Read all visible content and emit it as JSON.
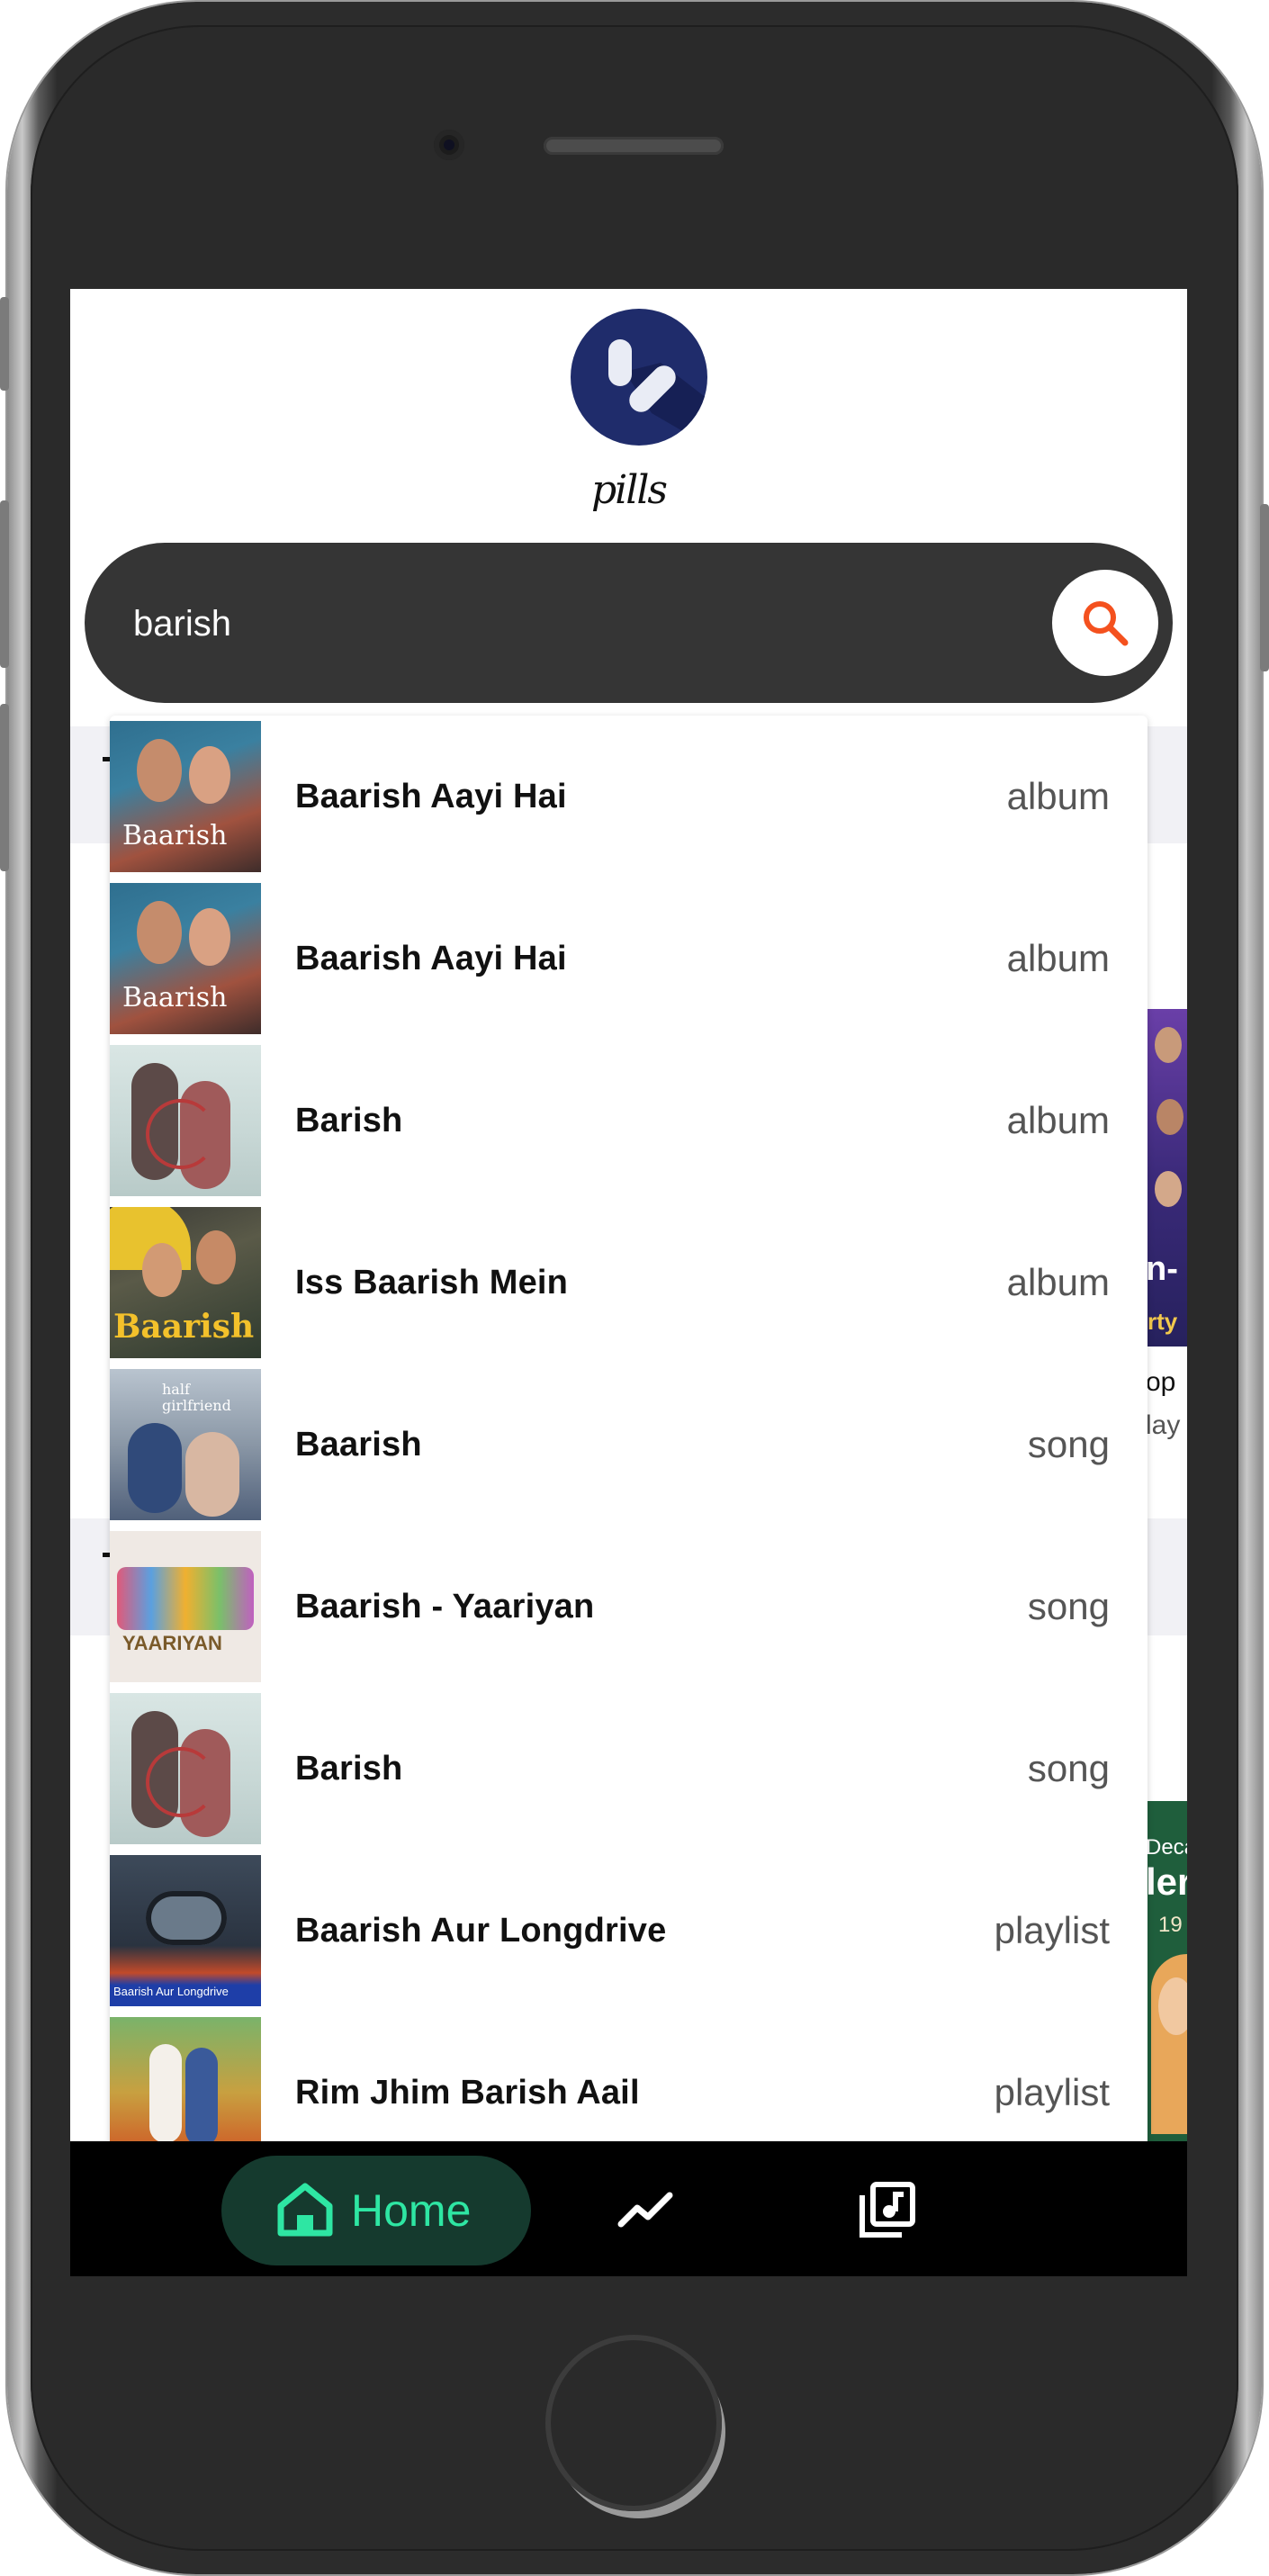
{
  "app": {
    "logo_text": "pills"
  },
  "search": {
    "value": "barish",
    "placeholder": ""
  },
  "results": [
    {
      "title": "Baarish Aayi Hai",
      "type": "album",
      "thumb": "baarish-aayi-hai-cover"
    },
    {
      "title": "Baarish Aayi Hai",
      "type": "album",
      "thumb": "baarish-aayi-hai-cover"
    },
    {
      "title": "Barish",
      "type": "album",
      "thumb": "barish-cover"
    },
    {
      "title": "Iss Baarish Mein",
      "type": "album",
      "thumb": "iss-baarish-mein-cover"
    },
    {
      "title": "Baarish",
      "type": "song",
      "thumb": "half-girlfriend-cover"
    },
    {
      "title": "Baarish - Yaariyan",
      "type": "song",
      "thumb": "yaariyan-cover"
    },
    {
      "title": "Barish",
      "type": "song",
      "thumb": "barish-cover"
    },
    {
      "title": "Baarish Aur Longdrive",
      "type": "playlist",
      "thumb": "baarish-aur-longdrive-cover"
    },
    {
      "title": "Rim Jhim Barish Aail",
      "type": "playlist",
      "thumb": "rim-jhim-cover"
    }
  ],
  "thumb_text": {
    "baarish": "Baarish",
    "half_girlfriend": "half girlfriend",
    "yaariyan": "YAARIYAN",
    "longdrive": "Baarish Aur Longdrive"
  },
  "background_peek": {
    "card1_a": "n-",
    "card1_b": "rty",
    "card1_c": "op",
    "card1_d": "lay",
    "card2_a": "Deca",
    "card2_b": "ler",
    "card2_c": "19"
  },
  "nav": {
    "items": [
      {
        "label": "Home",
        "icon": "home-icon",
        "active": true
      },
      {
        "label": "",
        "icon": "trending-icon",
        "active": false
      },
      {
        "label": "",
        "icon": "library-music-icon",
        "active": false
      }
    ]
  },
  "colors": {
    "accent": "#2ee6a3",
    "search_icon": "#f4511e",
    "search_bar": "#353535",
    "logo_bg": "#1f2c6b"
  }
}
